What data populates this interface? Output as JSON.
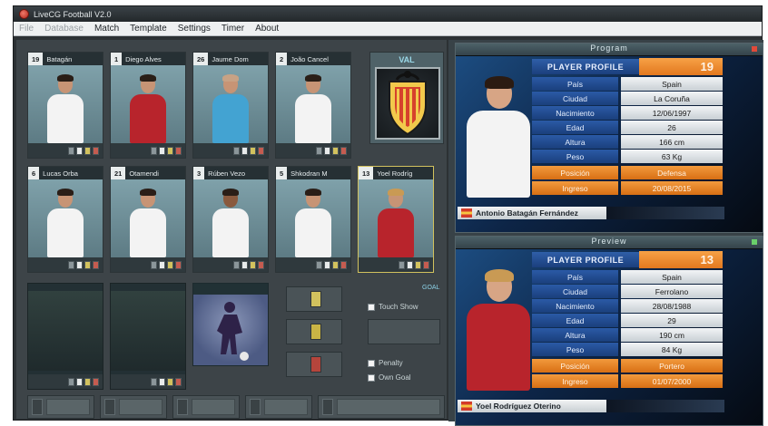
{
  "window": {
    "title": "LiveCG Football V2.0"
  },
  "menu": [
    "File",
    "Database",
    "Match",
    "Template",
    "Settings",
    "Timer",
    "About"
  ],
  "menu_disabled": [
    true,
    true,
    false,
    false,
    false,
    false,
    false
  ],
  "players": [
    {
      "num": "19",
      "name": "Batagán"
    },
    {
      "num": "1",
      "name": "Diego Alves"
    },
    {
      "num": "26",
      "name": "Jaume Dom"
    },
    {
      "num": "2",
      "name": "João Cancel"
    },
    {
      "num": "6",
      "name": "Lucas Orba"
    },
    {
      "num": "21",
      "name": "Otamendi"
    },
    {
      "num": "3",
      "name": "Rúben Vezo"
    },
    {
      "num": "5",
      "name": "Shkodran M"
    },
    {
      "num": "13",
      "name": "Yoel Rodríg"
    }
  ],
  "crest": {
    "label": "VAL"
  },
  "checkboxes": [
    {
      "label": "Touch Show"
    },
    {
      "label": "Penalty"
    },
    {
      "label": "Own Goal"
    }
  ],
  "small_link": "GOAL",
  "top_preview": {
    "title": "Program",
    "banner": "PLAYER PROFILE",
    "number": "19",
    "rows": [
      {
        "k": "País",
        "v": "Spain"
      },
      {
        "k": "Ciudad",
        "v": "La Coruña"
      },
      {
        "k": "Nacimiento",
        "v": "12/06/1997"
      },
      {
        "k": "Edad",
        "v": "26"
      },
      {
        "k": "Altura",
        "v": "166 cm"
      },
      {
        "k": "Peso",
        "v": "63 Kg"
      }
    ],
    "orange_rows": [
      {
        "k": "Posición",
        "v": "Defensa"
      },
      {
        "k": "Ingreso",
        "v": "20/08/2015"
      }
    ],
    "name": "Antonio Batagán Fernández"
  },
  "bottom_preview": {
    "title": "Preview",
    "banner": "PLAYER PROFILE",
    "number": "13",
    "rows": [
      {
        "k": "País",
        "v": "Spain"
      },
      {
        "k": "Ciudad",
        "v": "Ferrolano"
      },
      {
        "k": "Nacimiento",
        "v": "28/08/1988"
      },
      {
        "k": "Edad",
        "v": "29"
      },
      {
        "k": "Altura",
        "v": "190 cm"
      },
      {
        "k": "Peso",
        "v": "84 Kg"
      }
    ],
    "orange_rows": [
      {
        "k": "Posición",
        "v": "Portero"
      },
      {
        "k": "Ingreso",
        "v": "01/07/2000"
      }
    ],
    "name": "Yoel Rodríguez Oterino"
  },
  "colors": {
    "accent_orange": "#e2781f",
    "profile_blue": "#1b3f7d",
    "status_red": "#e04a3a",
    "status_green": "#6ad06a"
  }
}
